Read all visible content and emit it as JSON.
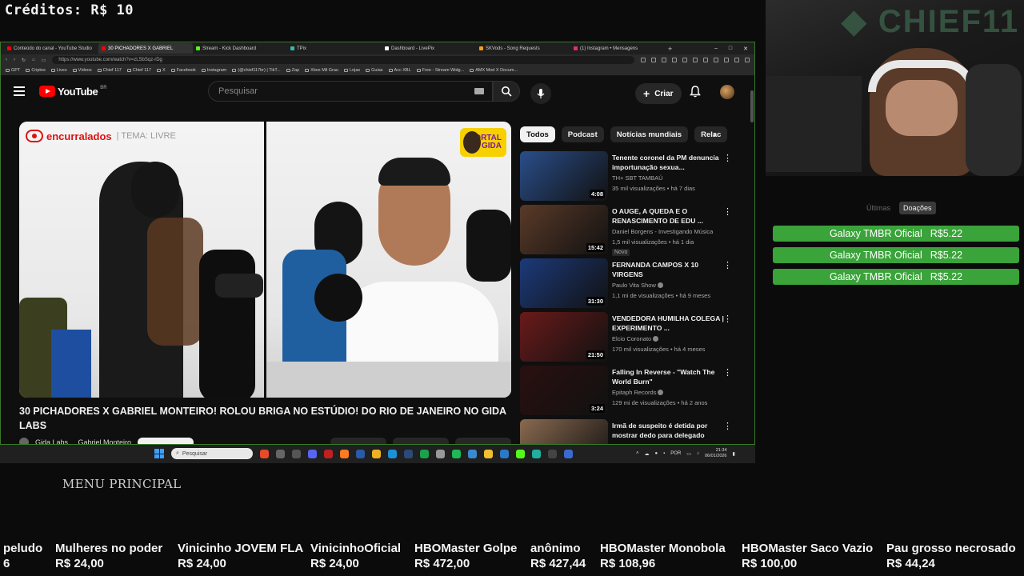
{
  "overlay": {
    "credits": "Créditos: R$ 10",
    "menu_principal": "MENU PRINCIPAL"
  },
  "browser": {
    "tabs": [
      {
        "label": "Conteúdo do canal - YouTube Studio",
        "color": "#ff0000"
      },
      {
        "label": "30 PICHADORES X GABRIEL",
        "color": "#ff0000"
      },
      {
        "label": "Stream - Kick Dashboard",
        "color": "#53fc18"
      },
      {
        "label": "TPix",
        "color": "#32bcad"
      },
      {
        "label": "Dashboard - LivePix",
        "color": "#ffffff"
      },
      {
        "label": "SKVods - Song Requests",
        "color": "#f0a020"
      },
      {
        "label": "(1) Instagram • Mensagens",
        "color": "#e1306c"
      }
    ],
    "url": "https://www.youtube.com/watch?v=zLSbSqz-rDg",
    "bookmarks": [
      "GPT",
      "Criptos",
      "Lives",
      "Vídeos",
      "Chief 117",
      "Chief 117",
      "X",
      "Facebook",
      "Instagram",
      "(@chief117br) | TikT...",
      "Zap",
      "Xbox Mil Grau",
      "Lojas",
      "Guias",
      "Acc XBL",
      "Free - Stream Widg...",
      "AMX Mod X Docum..."
    ]
  },
  "youtube": {
    "logo_text": "YouTube",
    "region": "BR",
    "search_placeholder": "Pesquisar",
    "create_label": "Criar",
    "video": {
      "brand": "encurralados",
      "tema": "| TEMA: LIVRE",
      "portal_line1": "PORTAL",
      "portal_line2": "GIDA",
      "title": "30 PICHADORES X GABRIEL MONTEIRO! ROLOU BRIGA NO ESTÚDIO! DO RIO DE JANEIRO NO GIDA LABS",
      "channel_partial": "Gida Labs ... Gabriel Monteiro"
    },
    "chips": [
      "Todos",
      "Podcast",
      "Notícias mundiais",
      "Relac"
    ],
    "recommendations": [
      {
        "title": "Tenente coronel da PM denuncia importunação sexua...",
        "channel": "TH+ SBT TAMBAÚ",
        "meta": "35 mil visualizações • há 7 dias",
        "duration": "4:08",
        "verified": false,
        "badge": "",
        "thumb": "#2a4e8a"
      },
      {
        "title": "O AUGE, A QUEDA E O RENASCIMENTO DE EDU ...",
        "channel": "Daniel Borgens - Investigando Música",
        "meta": "1,5 mil visualizações • há 1 dia",
        "duration": "15:42",
        "verified": false,
        "badge": "Novo",
        "thumb": "#5a3a28"
      },
      {
        "title": "FERNANDA CAMPOS X 10 VIRGENS",
        "channel": "Paulo Vita Show",
        "meta": "1,1 mi de visualizações • há 9 meses",
        "duration": "31:30",
        "verified": true,
        "badge": "",
        "thumb": "#1c3a7a"
      },
      {
        "title": "VENDEDORA HUMILHA COLEGA | EXPERIMENTO ...",
        "channel": "Elcio Coronato",
        "meta": "170 mil visualizações • há 4 meses",
        "duration": "21:50",
        "verified": true,
        "badge": "",
        "thumb": "#6a1a1a"
      },
      {
        "title": "Falling In Reverse - \"Watch The World Burn\"",
        "channel": "Epitaph Records",
        "meta": "129 mi de visualizações • há 2 anos",
        "duration": "3:24",
        "verified": true,
        "badge": "",
        "thumb": "#2a1010"
      },
      {
        "title": "Irmã de suspeito é detida por mostrar dedo para delegado",
        "channel": "",
        "meta": "",
        "duration": "",
        "verified": false,
        "badge": "",
        "thumb": "#8a6a50"
      }
    ]
  },
  "taskbar": {
    "search_placeholder": "Pesquisar",
    "lang": "POR",
    "time": "21:34",
    "date": "06/01/2026"
  },
  "donations": {
    "tabs": [
      "Últimas",
      "Doações"
    ],
    "items": [
      {
        "name": "Galaxy TMBR Oficial",
        "amount": "R$5.22"
      },
      {
        "name": "Galaxy TMBR Oficial",
        "amount": "R$5.22"
      },
      {
        "name": "Galaxy TMBR Oficial",
        "amount": "R$5.22"
      }
    ]
  },
  "ticker": [
    {
      "name": "peludo",
      "amount": "6"
    },
    {
      "name": "Mulheres no poder",
      "amount": "R$ 24,00"
    },
    {
      "name": "Vinicinho JOVEM FLA",
      "amount": "R$ 24,00"
    },
    {
      "name": "VinicinhoOficial",
      "amount": "R$ 24,00"
    },
    {
      "name": "HBOMaster Golpe",
      "amount": "R$ 472,00"
    },
    {
      "name": "anônimo",
      "amount": "R$ 427,44"
    },
    {
      "name": "HBOMaster Monobola",
      "amount": "R$ 108,96"
    },
    {
      "name": "HBOMaster Saco Vazio",
      "amount": "R$ 100,00"
    },
    {
      "name": "Pau grosso necrosado",
      "amount": "R$ 44,24"
    }
  ]
}
